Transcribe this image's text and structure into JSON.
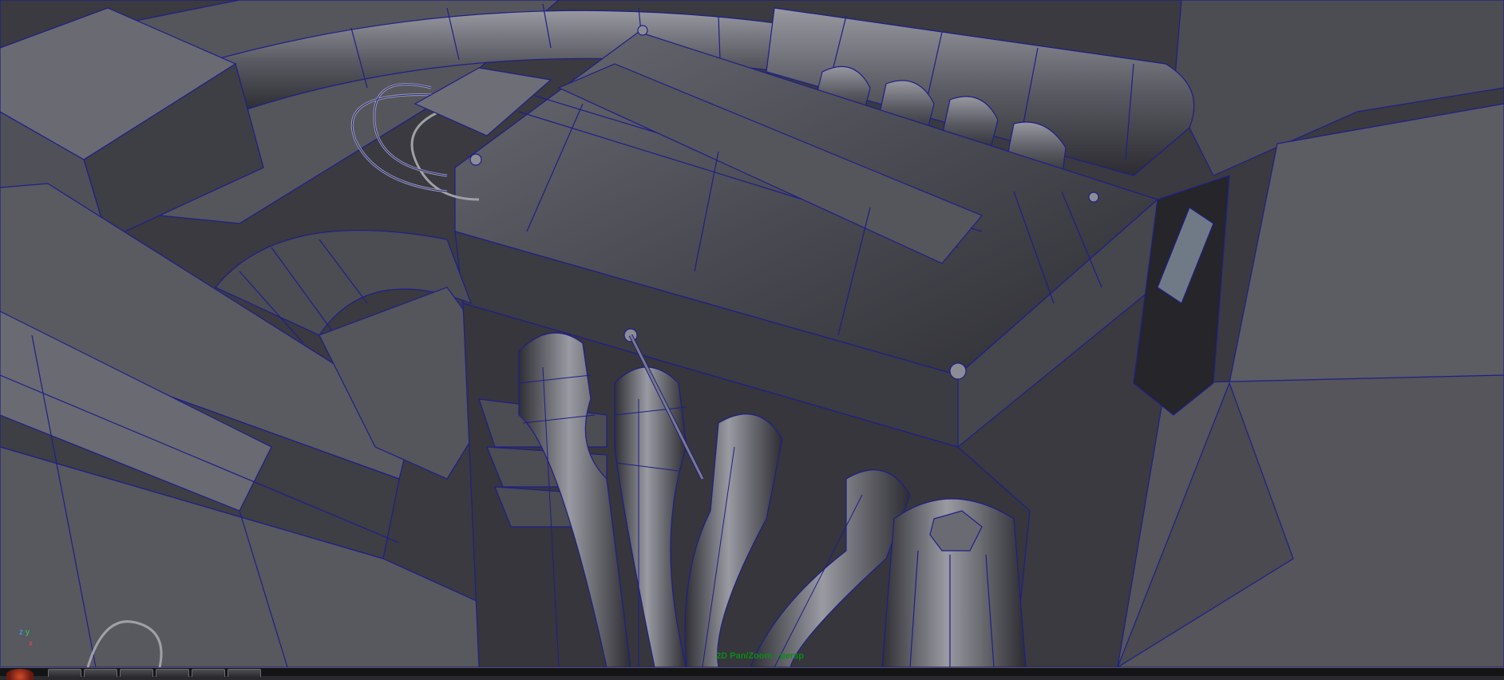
{
  "viewport": {
    "panel_label": "2D Pan/Zoom : persp",
    "camera": "persp",
    "axis_labels": {
      "x": "x",
      "y": "y",
      "z": "z"
    }
  },
  "colors": {
    "wireframe": "#1e1f8a",
    "panel_label": "#0b8a17",
    "background": "#3c3c42"
  },
  "taskbar": {
    "start_icon": "windows-start-orb-icon",
    "button_count": 6
  }
}
